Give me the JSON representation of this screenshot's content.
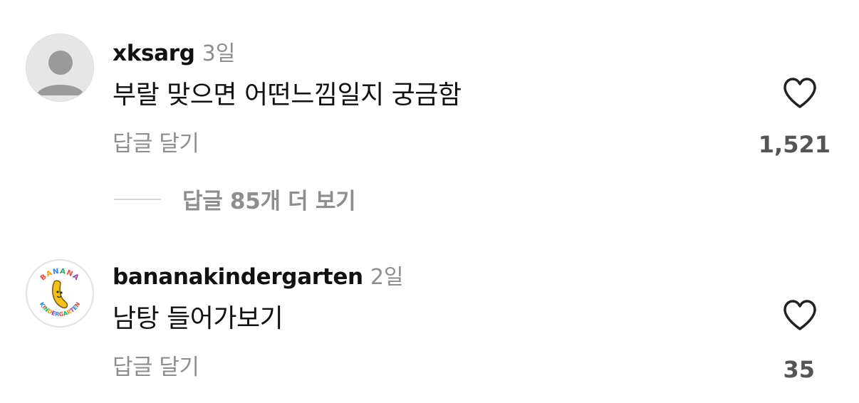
{
  "comments": [
    {
      "username": "xksarg",
      "time": "3일",
      "text": "부랄 맞으면 어떤느낌일지 궁금함",
      "reply_label": "답글 달기",
      "like_count": "1,521",
      "view_replies": "답글 85개 더 보기",
      "avatar_icon": "default-person-icon"
    },
    {
      "username": "bananakindergarten",
      "time": "2일",
      "text": "남탕 들어가보기",
      "reply_label": "답글 달기",
      "like_count": "35",
      "avatar_icon": "banana-kindergarten-logo",
      "avatar_logo_text": "BANANA KINDERGARTEN"
    }
  ],
  "colors": {
    "text": "#111111",
    "muted": "#8e8e8e",
    "like_count": "#555555",
    "banana": "#f2c21b"
  }
}
